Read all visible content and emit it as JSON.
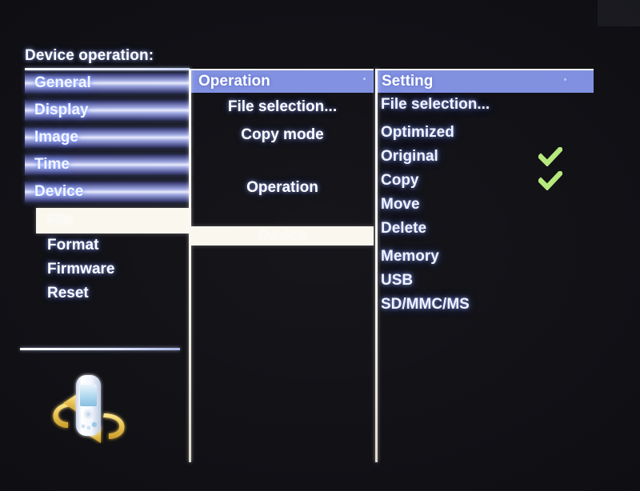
{
  "screen": {
    "title": "Device operation:",
    "background_color": "#0d0d12",
    "accent_header_color": "#7f8fe0",
    "highlight_color": "#faf7ee",
    "check_color": "#b5e87a"
  },
  "sidebar": {
    "items": [
      {
        "label": "General",
        "style": "bar",
        "selected": false
      },
      {
        "label": "Display",
        "style": "bar",
        "selected": false
      },
      {
        "label": "Image",
        "style": "bar",
        "selected": false
      },
      {
        "label": "Time",
        "style": "bar",
        "selected": false
      },
      {
        "label": "Device",
        "style": "bar",
        "selected": false
      }
    ],
    "subitems": [
      {
        "label": "File",
        "selected": true
      },
      {
        "label": "Format",
        "selected": false
      },
      {
        "label": "Firmware",
        "selected": false
      },
      {
        "label": "Reset",
        "selected": false
      }
    ],
    "device_icon": "usb-media-player-rotate-icon"
  },
  "middle_column": {
    "header": "Operation",
    "items": [
      {
        "label": "File selection...",
        "highlight": false
      },
      {
        "label": "Copy mode",
        "highlight": false
      },
      {
        "label": "",
        "highlight": false,
        "spacer": true
      },
      {
        "label": "Operation",
        "highlight": false
      },
      {
        "label": "",
        "highlight": false,
        "spacer": true
      },
      {
        "label": "Device",
        "highlight": true
      }
    ]
  },
  "right_column": {
    "header": "Setting",
    "items": [
      {
        "label": "File selection...",
        "checked": false,
        "gap_above": false
      },
      {
        "label": "Optimized",
        "checked": false,
        "gap_above": true
      },
      {
        "label": "Original",
        "checked": true,
        "gap_above": false
      },
      {
        "label": "Copy",
        "checked": true,
        "gap_above": false
      },
      {
        "label": "Move",
        "checked": false,
        "gap_above": false
      },
      {
        "label": "Delete",
        "checked": false,
        "gap_above": false
      },
      {
        "label": "Memory",
        "checked": false,
        "gap_above": true
      },
      {
        "label": "USB",
        "checked": false,
        "gap_above": false
      },
      {
        "label": "SD/MMC/MS",
        "checked": false,
        "gap_above": false
      }
    ]
  }
}
